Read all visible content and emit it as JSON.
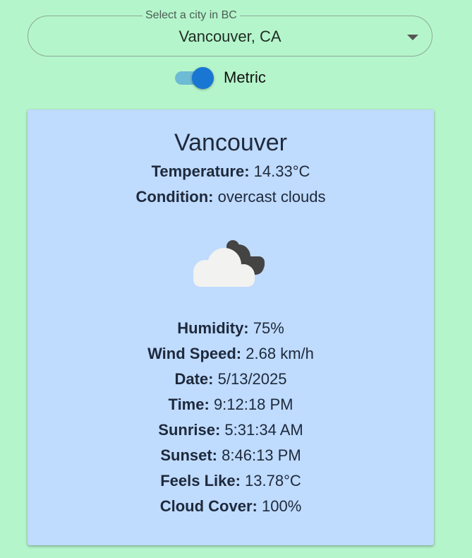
{
  "city_select": {
    "label": "Select a city in BC",
    "value": "Vancouver, CA",
    "icon": "chevron-down-icon"
  },
  "units_toggle": {
    "label": "Metric",
    "checked": true
  },
  "weather": {
    "city": "Vancouver",
    "icon": "overcast-clouds-icon",
    "details": [
      {
        "label": "Temperature:",
        "value": "14.33°C"
      },
      {
        "label": "Condition:",
        "value": "overcast clouds"
      },
      {
        "label": "Humidity:",
        "value": "75%"
      },
      {
        "label": "Wind Speed:",
        "value": "2.68 km/h"
      },
      {
        "label": "Date:",
        "value": "5/13/2025"
      },
      {
        "label": "Time:",
        "value": "9:12:18 PM"
      },
      {
        "label": "Sunrise:",
        "value": "5:31:34 AM"
      },
      {
        "label": "Sunset:",
        "value": "8:46:13 PM"
      },
      {
        "label": "Feels Like:",
        "value": "13.78°C"
      },
      {
        "label": "Cloud Cover:",
        "value": "100%"
      }
    ]
  }
}
